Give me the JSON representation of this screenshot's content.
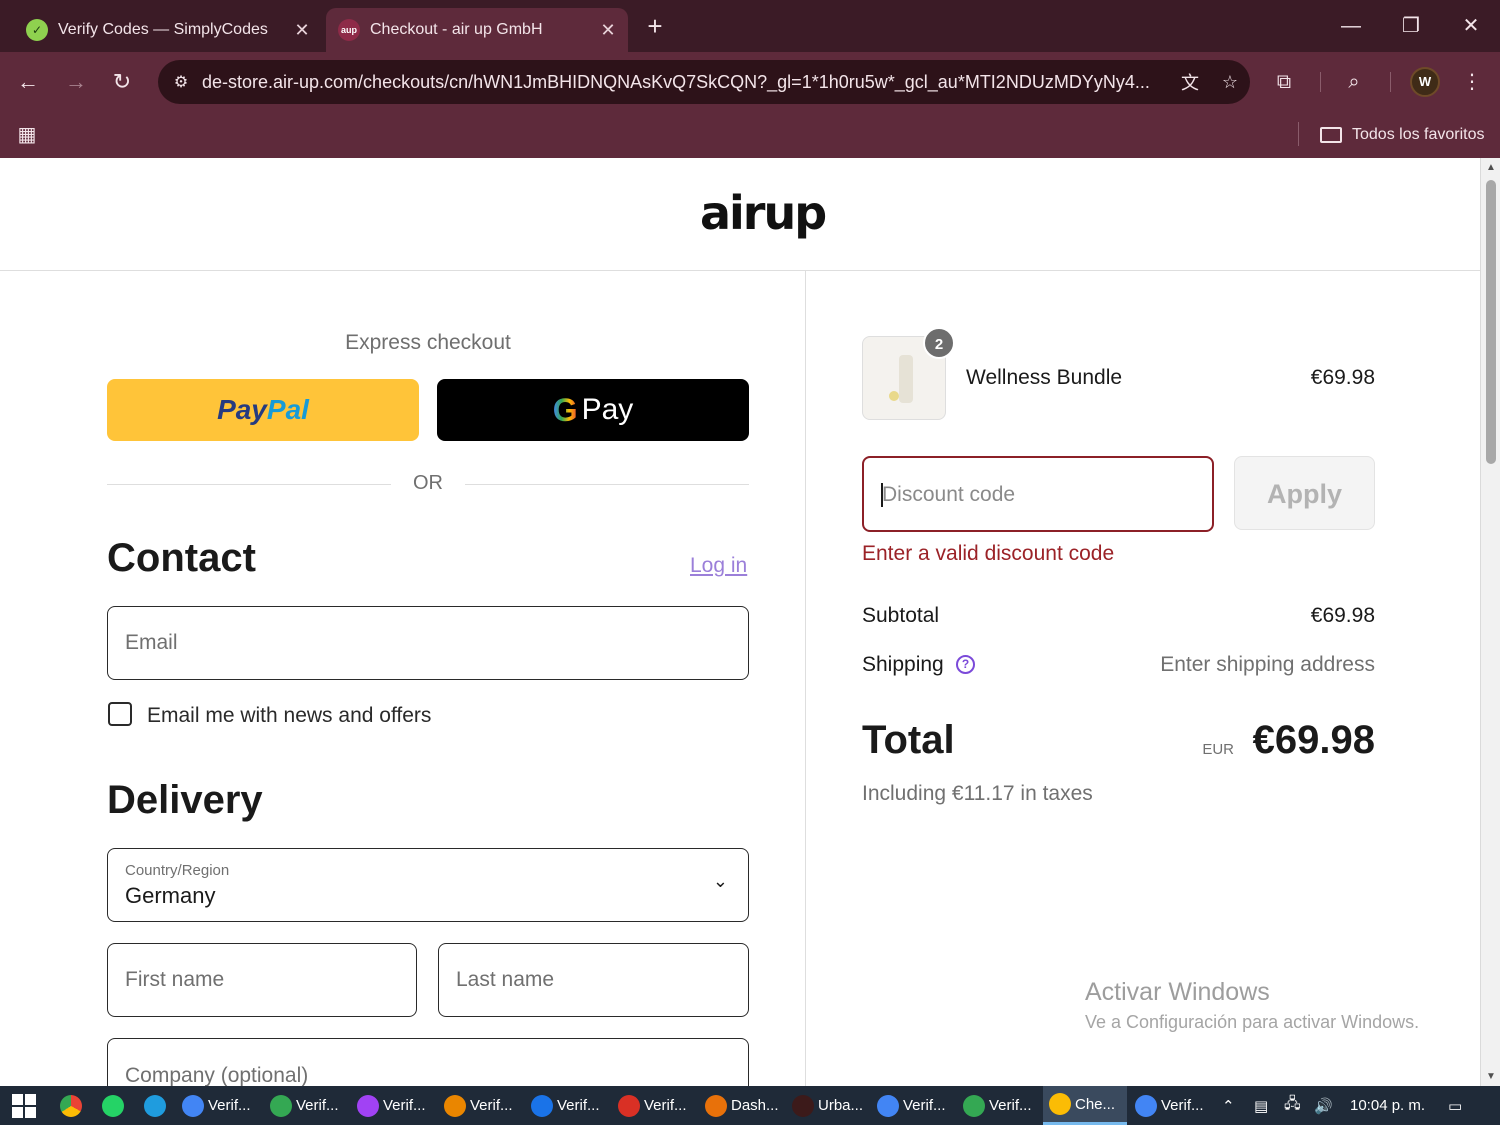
{
  "browser": {
    "tabs": [
      {
        "title": "Verify Codes — SimplyCodes",
        "favicon": "simplycodes-icon",
        "active": false
      },
      {
        "title": "Checkout - air up GmbH",
        "favicon": "airup-icon",
        "active": true
      }
    ],
    "new_tab": "+",
    "url": "de-store.air-up.com/checkouts/cn/hWN1JmBHIDNQNAsKvQ7SkCQN?_gl=1*1h0ru5w*_gcl_au*MTI2NDUzMDYyNy4...",
    "profile_initial": "W",
    "all_bookmarks": "Todos los favoritos",
    "colors": {
      "tab_strip": "#3b1b26",
      "toolbar": "#5e2a3b"
    }
  },
  "header": {
    "logo": "airup"
  },
  "express": {
    "label": "Express checkout",
    "paypal_part1": "Pay",
    "paypal_part2": "Pal",
    "gpay_g": "G",
    "gpay_text": "Pay",
    "or": "OR"
  },
  "contact": {
    "title": "Contact",
    "login": "Log in",
    "email_placeholder": "Email",
    "newsletter_label": "Email me with news and offers"
  },
  "delivery": {
    "title": "Delivery",
    "country_label": "Country/Region",
    "country_value": "Germany",
    "first_name_placeholder": "First name",
    "last_name_placeholder": "Last name",
    "company_placeholder": "Company (optional)"
  },
  "summary": {
    "item_qty": "2",
    "item_name": "Wellness Bundle",
    "item_price": "€69.98",
    "discount_placeholder": "Discount code",
    "apply": "Apply",
    "discount_error": "Enter a valid discount code",
    "subtotal_label": "Subtotal",
    "subtotal_value": "€69.98",
    "shipping_label": "Shipping",
    "shipping_value": "Enter shipping address",
    "total_label": "Total",
    "currency": "EUR",
    "total_value": "€69.98",
    "taxes": "Including €11.17 in taxes",
    "error_color": "#9b2227"
  },
  "watermark": {
    "line1": "Activar Windows",
    "line2": "Ve a Configuración para activar Windows."
  },
  "taskbar": {
    "apps": [
      "Verif...",
      "Verif...",
      "Verif...",
      "Verif...",
      "Verif...",
      "Verif...",
      "Dash...",
      "Urba...",
      "Verif...",
      "Verif...",
      "Che...",
      "Verif..."
    ],
    "clock": "10:04 p. m."
  }
}
